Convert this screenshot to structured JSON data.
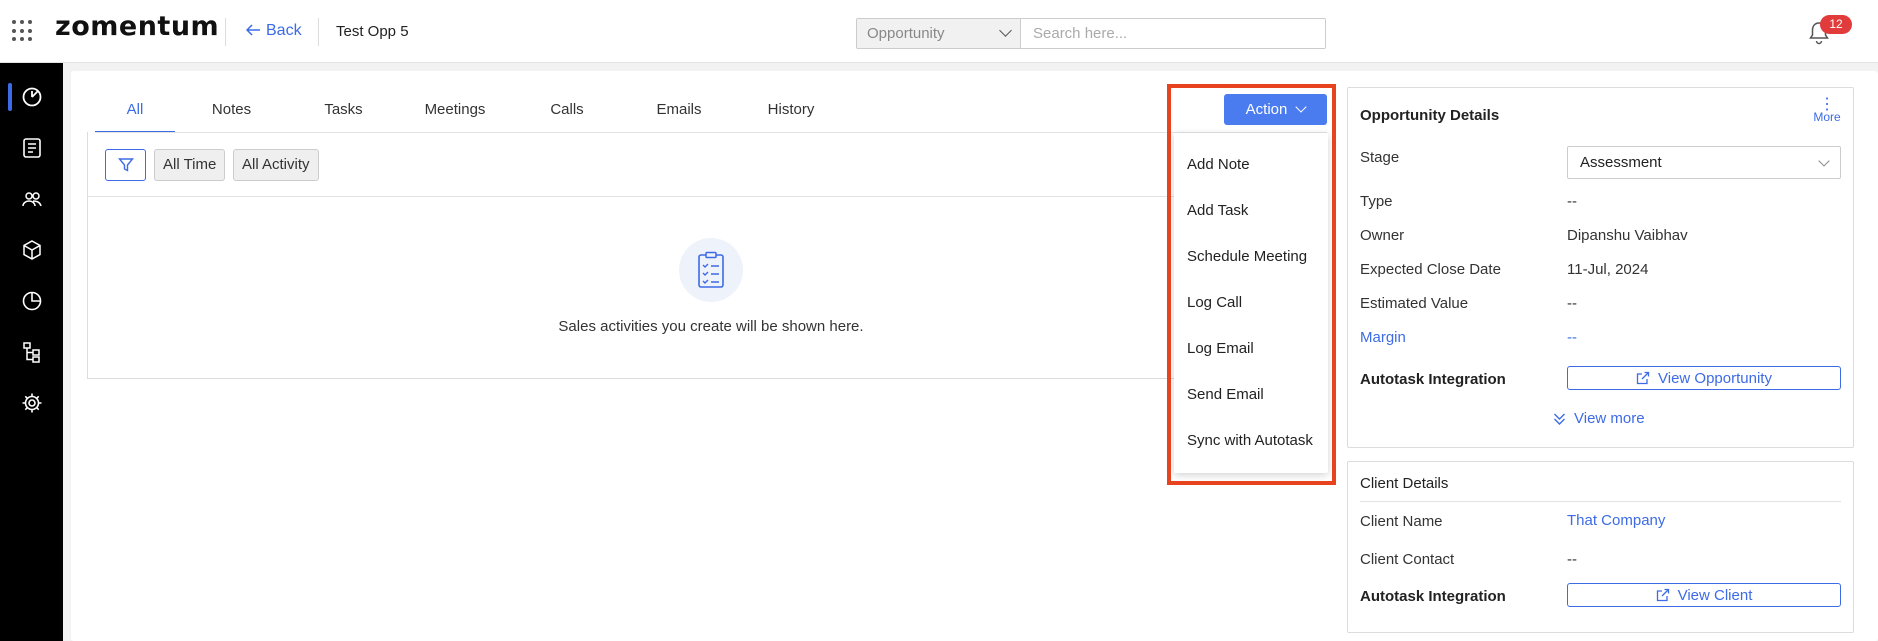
{
  "header": {
    "logo": "zomentum",
    "back_label": "Back",
    "opportunity_title": "Test Opp 5",
    "search_scope": "Opportunity",
    "search_placeholder": "Search here...",
    "notification_count": "12"
  },
  "sidebar": {
    "items": [
      {
        "name": "dashboard-icon",
        "active": true
      },
      {
        "name": "documents-icon",
        "active": false
      },
      {
        "name": "clients-icon",
        "active": false
      },
      {
        "name": "products-icon",
        "active": false
      },
      {
        "name": "reports-icon",
        "active": false
      },
      {
        "name": "workflows-icon",
        "active": false
      },
      {
        "name": "settings-icon",
        "active": false
      }
    ]
  },
  "activity": {
    "tabs": [
      "All",
      "Notes",
      "Tasks",
      "Meetings",
      "Calls",
      "Emails",
      "History"
    ],
    "active_tab": "All",
    "filters": {
      "time": "All Time",
      "activity": "All Activity"
    },
    "empty_message": "Sales activities you create will be shown here."
  },
  "action_menu": {
    "button_label": "Action",
    "items": [
      "Add Note",
      "Add Task",
      "Schedule Meeting",
      "Log Call",
      "Log Email",
      "Send Email",
      "Sync with Autotask"
    ]
  },
  "opportunity_details": {
    "title": "Opportunity Details",
    "more_label": "More",
    "stage_label": "Stage",
    "stage_value": "Assessment",
    "type_label": "Type",
    "type_value": "--",
    "owner_label": "Owner",
    "owner_value": "Dipanshu Vaibhav",
    "close_date_label": "Expected Close Date",
    "close_date_value": "11-Jul, 2024",
    "estimated_value_label": "Estimated Value",
    "estimated_value_value": "--",
    "margin_label": "Margin",
    "margin_value": "--",
    "integration_label": "Autotask Integration",
    "view_opportunity_label": "View Opportunity",
    "view_more_label": "View more"
  },
  "client_details": {
    "title": "Client Details",
    "client_name_label": "Client Name",
    "client_name_value": "That Company",
    "client_contact_label": "Client Contact",
    "client_contact_value": "--",
    "integration_label": "Autotask Integration",
    "view_client_label": "View Client"
  },
  "colors": {
    "accent": "#3d6be6",
    "action_button": "#4a7cf0",
    "highlight_border": "#e8431f",
    "badge": "#e23b3b",
    "sidebar_bg": "#000000"
  }
}
